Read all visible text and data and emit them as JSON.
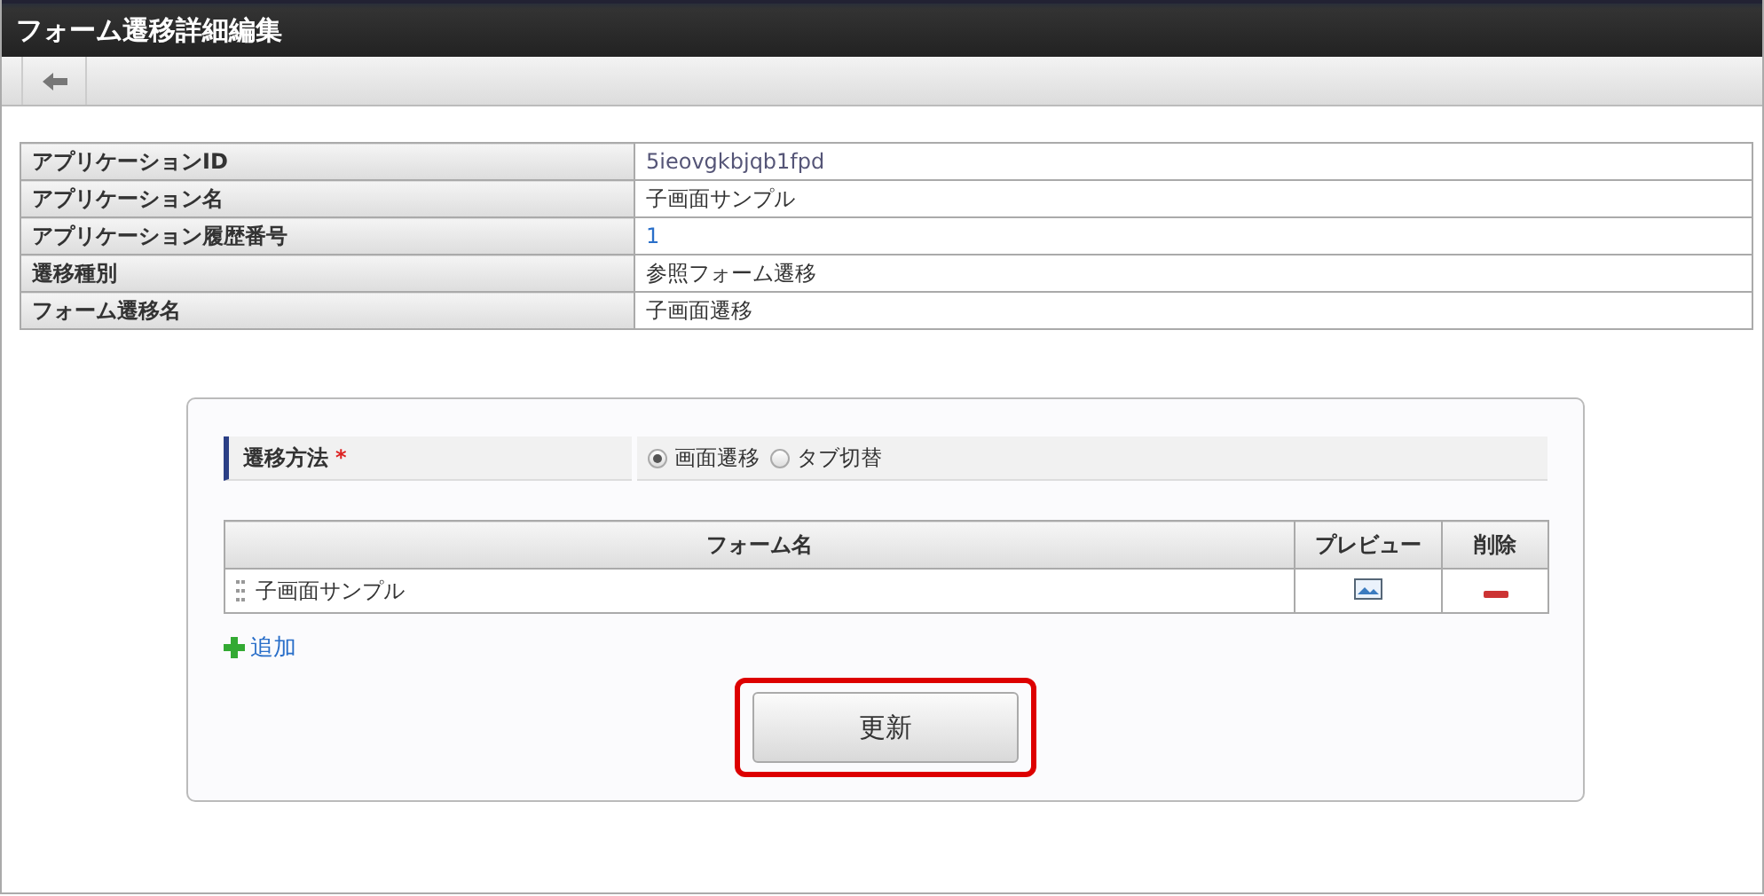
{
  "window": {
    "title": "フォーム遷移詳細編集"
  },
  "info_table": [
    {
      "label": "アプリケーションID",
      "value": "5ieovgkbjqb1fpd",
      "kind": "muted"
    },
    {
      "label": "アプリケーション名",
      "value": "子画面サンプル",
      "kind": "plain"
    },
    {
      "label": "アプリケーション履歴番号",
      "value": "1",
      "kind": "link"
    },
    {
      "label": "遷移種別",
      "value": "参照フォーム遷移",
      "kind": "plain"
    },
    {
      "label": "フォーム遷移名",
      "value": "子画面遷移",
      "kind": "plain"
    }
  ],
  "form": {
    "label": "遷移方法",
    "required_mark": "*",
    "options": [
      {
        "label": "画面遷移",
        "selected": true
      },
      {
        "label": "タブ切替",
        "selected": false
      }
    ]
  },
  "grid": {
    "columns": [
      "フォーム名",
      "プレビュー",
      "削除"
    ],
    "rows": [
      {
        "name": "子画面サンプル"
      }
    ]
  },
  "add_link": "追加",
  "update_button": {
    "label": "更新",
    "highlighted": true
  }
}
